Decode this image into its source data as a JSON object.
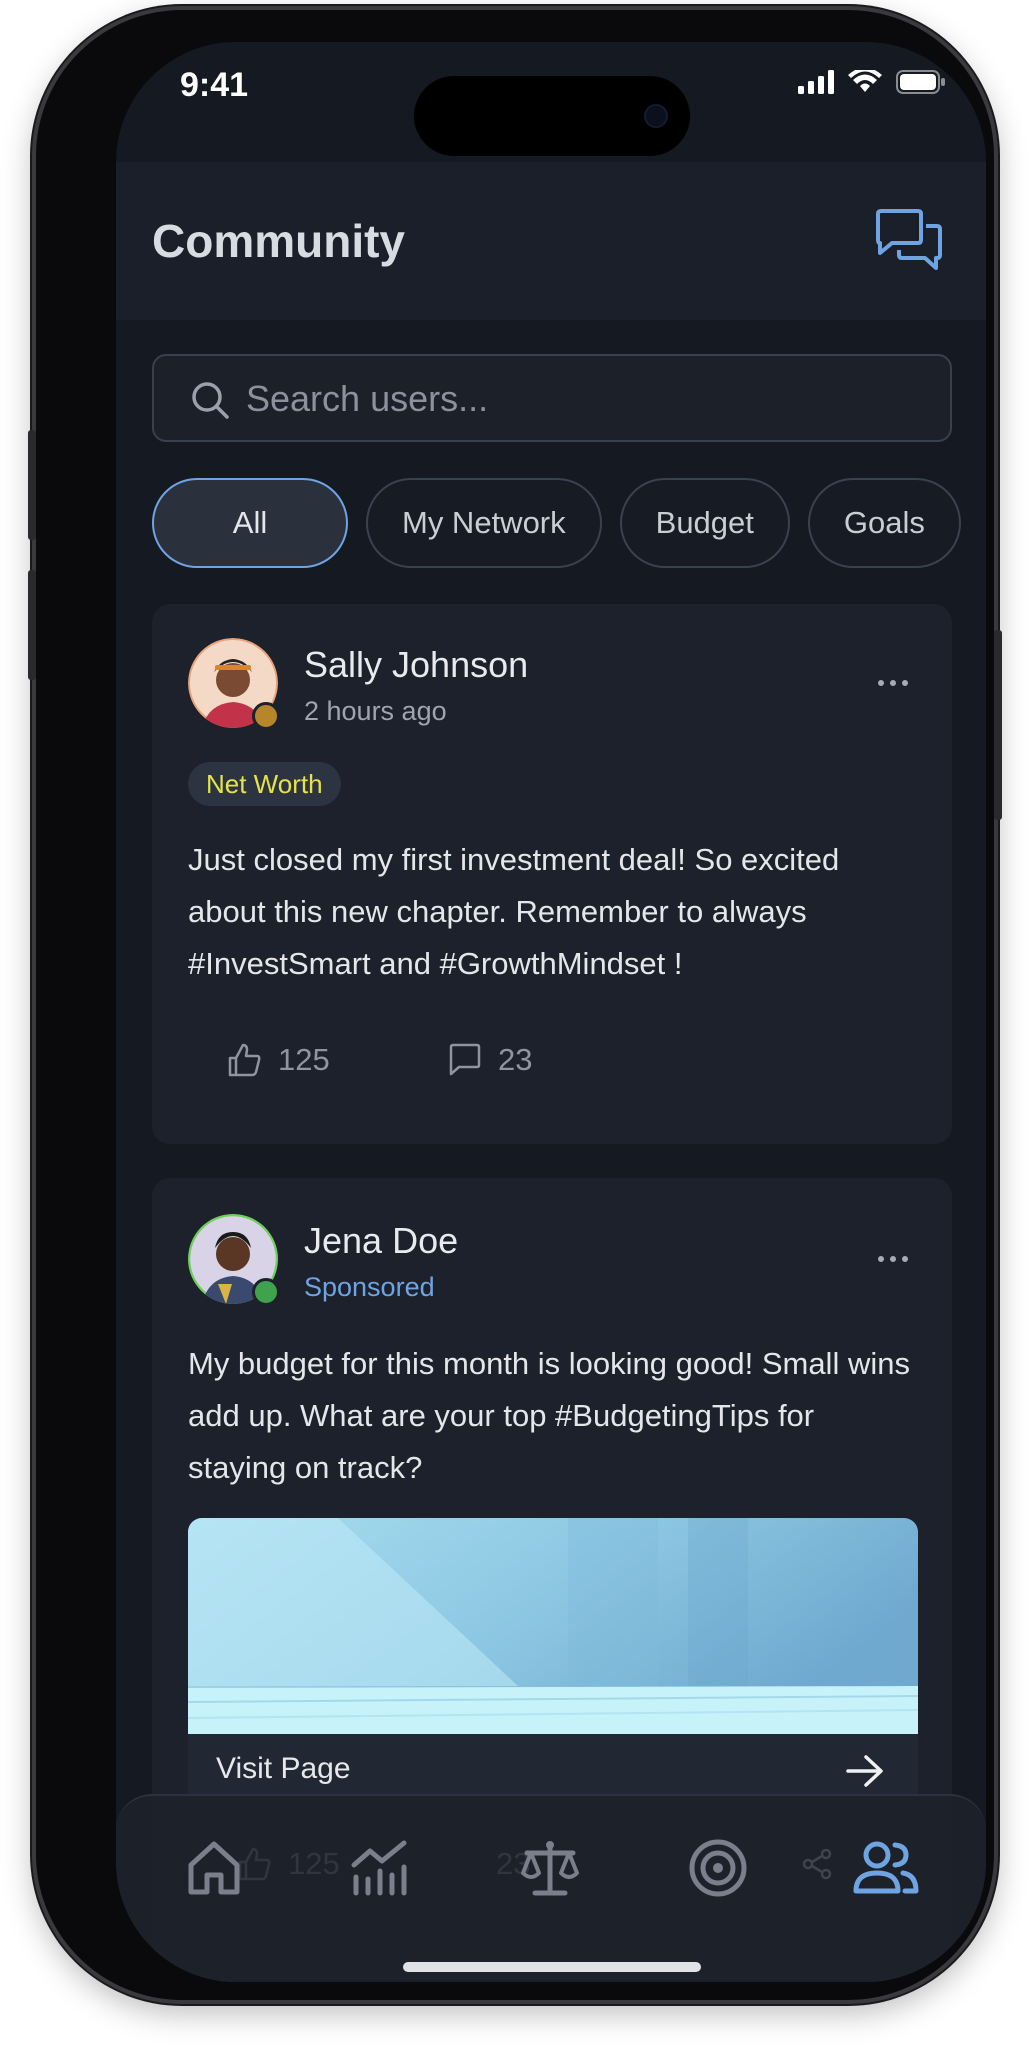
{
  "status_bar": {
    "time": "9:41"
  },
  "header": {
    "title": "Community",
    "chat_icon": "chat-bubbles-icon"
  },
  "search": {
    "placeholder": "Search users..."
  },
  "filters": [
    "All",
    "My Network",
    "Budget",
    "Goals"
  ],
  "active_filter": "All",
  "posts": [
    {
      "author": "Sally Johnson",
      "meta": "2 hours ago",
      "tag": "Net Worth",
      "text": "Just closed my first investment deal! So excited about this new chapter. Remember to always #InvestSmart and #GrowthMindset !",
      "likes": "125",
      "comments": "23"
    },
    {
      "author": "Jena Doe",
      "meta": "Sponsored",
      "text": "My budget for this month is looking good! Small wins add up. What are your top #BudgetingTips for staying on track?",
      "cta": "Visit Page",
      "likes": "125",
      "comments": "23"
    }
  ],
  "tabbar": {
    "items": [
      "home-icon",
      "analytics-icon",
      "balance-icon",
      "goals-target-icon",
      "community-icon"
    ],
    "active": "community-icon"
  },
  "colors": {
    "background": "#141922",
    "card": "#1c212b",
    "accent": "#6fa4e3",
    "tag_text": "#e6e24a",
    "sponsored": "#6fa4e3"
  }
}
